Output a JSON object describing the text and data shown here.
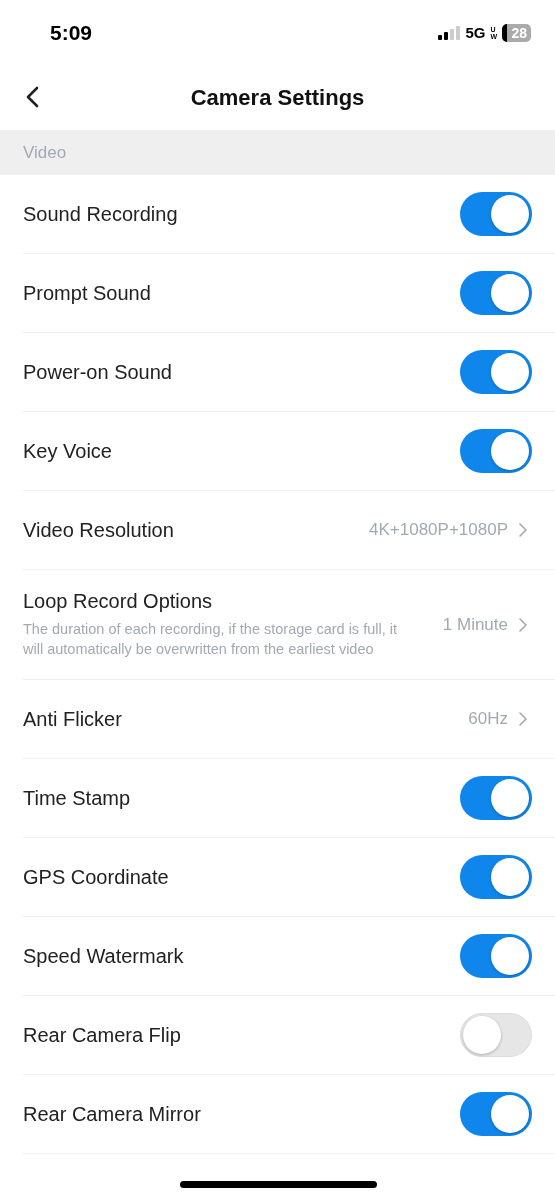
{
  "status_bar": {
    "time": "5:09",
    "network": "5G",
    "network_sub": "UW",
    "battery": "28"
  },
  "nav": {
    "title": "Camera Settings"
  },
  "section": {
    "title": "Video"
  },
  "rows": [
    {
      "kind": "toggle",
      "label": "Sound Recording",
      "on": true
    },
    {
      "kind": "toggle",
      "label": "Prompt Sound",
      "on": true
    },
    {
      "kind": "toggle",
      "label": "Power-on Sound",
      "on": true
    },
    {
      "kind": "toggle",
      "label": "Key Voice",
      "on": true
    },
    {
      "kind": "value",
      "label": "Video Resolution",
      "value": "4K+1080P+1080P"
    },
    {
      "kind": "value",
      "label": "Loop Record Options",
      "description": "The duration of each recording, if the storage card is full, it will automatically be overwritten from the earliest video",
      "value": "1 Minute"
    },
    {
      "kind": "value",
      "label": "Anti Flicker",
      "value": "60Hz"
    },
    {
      "kind": "toggle",
      "label": "Time Stamp",
      "on": true
    },
    {
      "kind": "toggle",
      "label": "GPS Coordinate",
      "on": true
    },
    {
      "kind": "toggle",
      "label": "Speed Watermark",
      "on": true
    },
    {
      "kind": "toggle",
      "label": "Rear Camera Flip",
      "on": false
    },
    {
      "kind": "toggle",
      "label": "Rear Camera Mirror",
      "on": true
    }
  ]
}
